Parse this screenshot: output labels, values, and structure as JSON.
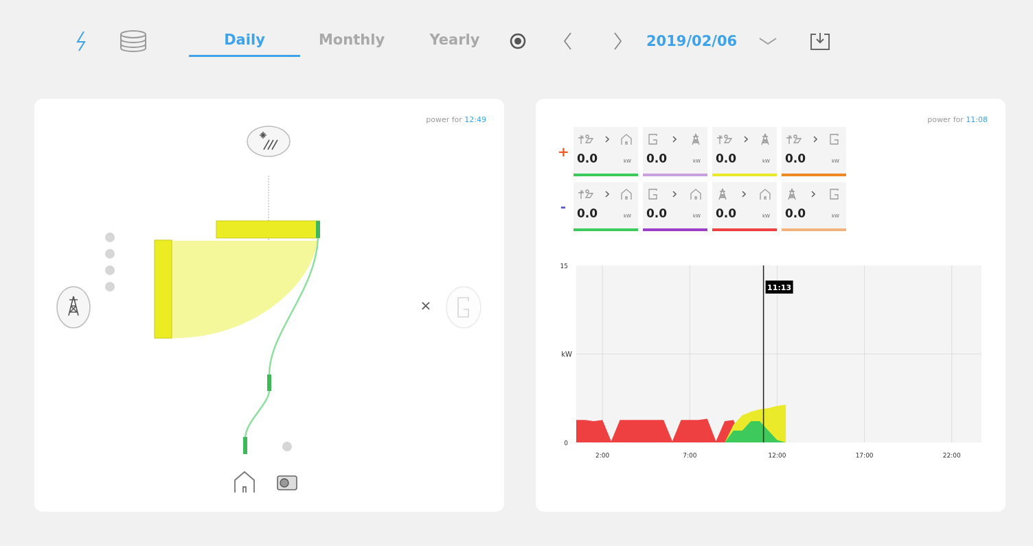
{
  "toolbar": {
    "views": [
      {
        "kind": "power",
        "selected": true
      },
      {
        "kind": "storage",
        "selected": false
      }
    ],
    "tabs": [
      {
        "label": "Daily",
        "selected": true
      },
      {
        "label": "Monthly",
        "selected": false
      },
      {
        "label": "Yearly",
        "selected": false
      }
    ],
    "date": "2019/02/06"
  },
  "flow_panel": {
    "caption": "power for",
    "time": "12:49",
    "nodes": [
      {
        "kind": "solar",
        "disabled": false
      },
      {
        "kind": "grid",
        "disabled": false
      },
      {
        "kind": "generator",
        "disabled": true,
        "mark": "×"
      },
      {
        "kind": "home",
        "disabled": false
      },
      {
        "kind": "device",
        "disabled": false
      }
    ]
  },
  "chart_panel": {
    "caption": "power for",
    "time": "11:08",
    "flow_rows": [
      {
        "sign": "+",
        "cells": [
          {
            "from": {
              "kind": "solar"
            },
            "to": {
              "kind": "home"
            },
            "value": "0.0",
            "unit": "kW",
            "color": "#3ec95c"
          },
          {
            "from": {
              "kind": "generator"
            },
            "to": {
              "kind": "grid"
            },
            "value": "0.0",
            "unit": "kW",
            "color": "#c9a0dc"
          },
          {
            "from": {
              "kind": "solar"
            },
            "to": {
              "kind": "grid"
            },
            "value": "0.0",
            "unit": "kW",
            "color": "#eaea2a"
          },
          {
            "from": {
              "kind": "solar"
            },
            "to": {
              "kind": "generator"
            },
            "value": "0.0",
            "unit": "kW",
            "color": "#ee8a22"
          }
        ]
      },
      {
        "sign": "-",
        "cells": [
          {
            "from": {
              "kind": "solar"
            },
            "to": {
              "kind": "home"
            },
            "value": "0.0",
            "unit": "kW",
            "color": "#3ec95c"
          },
          {
            "from": {
              "kind": "generator"
            },
            "to": {
              "kind": "home"
            },
            "value": "0.0",
            "unit": "kW",
            "color": "#9b3fc8"
          },
          {
            "from": {
              "kind": "grid"
            },
            "to": {
              "kind": "home"
            },
            "value": "0.0",
            "unit": "kW",
            "color": "#ee4040"
          },
          {
            "from": {
              "kind": "grid"
            },
            "to": {
              "kind": "generator"
            },
            "value": "0.0",
            "unit": "kW",
            "color": "#f2b27a"
          }
        ]
      }
    ],
    "chart_data": {
      "type": "area",
      "grid": true,
      "ylabel": "kW",
      "xlim": [
        0.5,
        23.7
      ],
      "ylim": [
        0,
        15
      ],
      "yticks": [
        0,
        15
      ],
      "xticks": [
        {
          "value": 2,
          "label": "2:00"
        },
        {
          "value": 7,
          "label": "7:00"
        },
        {
          "value": 12,
          "label": "12:00"
        },
        {
          "value": 17,
          "label": "17:00"
        },
        {
          "value": 22,
          "label": "22:00"
        }
      ],
      "x": [
        0.5,
        1,
        1.5,
        2,
        2.5,
        3,
        3.5,
        4,
        4.5,
        5,
        5.5,
        6,
        6.5,
        7,
        7.5,
        8,
        8.5,
        9,
        9.5,
        10,
        10.5,
        11,
        11.5,
        12,
        12.5
      ],
      "series": [
        {
          "color": "#ee4040",
          "values": [
            1.9,
            1.9,
            1.8,
            1.9,
            0.1,
            1.9,
            1.9,
            1.9,
            1.9,
            1.9,
            1.9,
            0.1,
            1.9,
            1.9,
            1.9,
            2.0,
            0.1,
            1.8,
            1.9,
            0,
            0,
            0,
            0,
            0,
            0
          ]
        },
        {
          "color": "#eaea2a",
          "values": [
            0,
            0,
            0,
            0,
            0,
            0,
            0,
            0,
            0,
            0,
            0,
            0,
            0,
            0,
            0,
            0,
            0,
            0,
            1.5,
            2.3,
            2.6,
            2.8,
            2.9,
            3.1,
            3.2
          ]
        },
        {
          "color": "#3ec95c",
          "values": [
            0,
            0,
            0,
            0,
            0,
            0,
            0,
            0,
            0,
            0,
            0,
            0,
            0,
            0,
            0,
            0,
            0,
            0,
            1.0,
            1.0,
            1.8,
            1.8,
            1.0,
            0.2,
            0
          ]
        }
      ],
      "ref_lines": [
        {
          "axis": "x",
          "value": 11.22
        }
      ],
      "annotations": [
        "11:13"
      ]
    }
  }
}
